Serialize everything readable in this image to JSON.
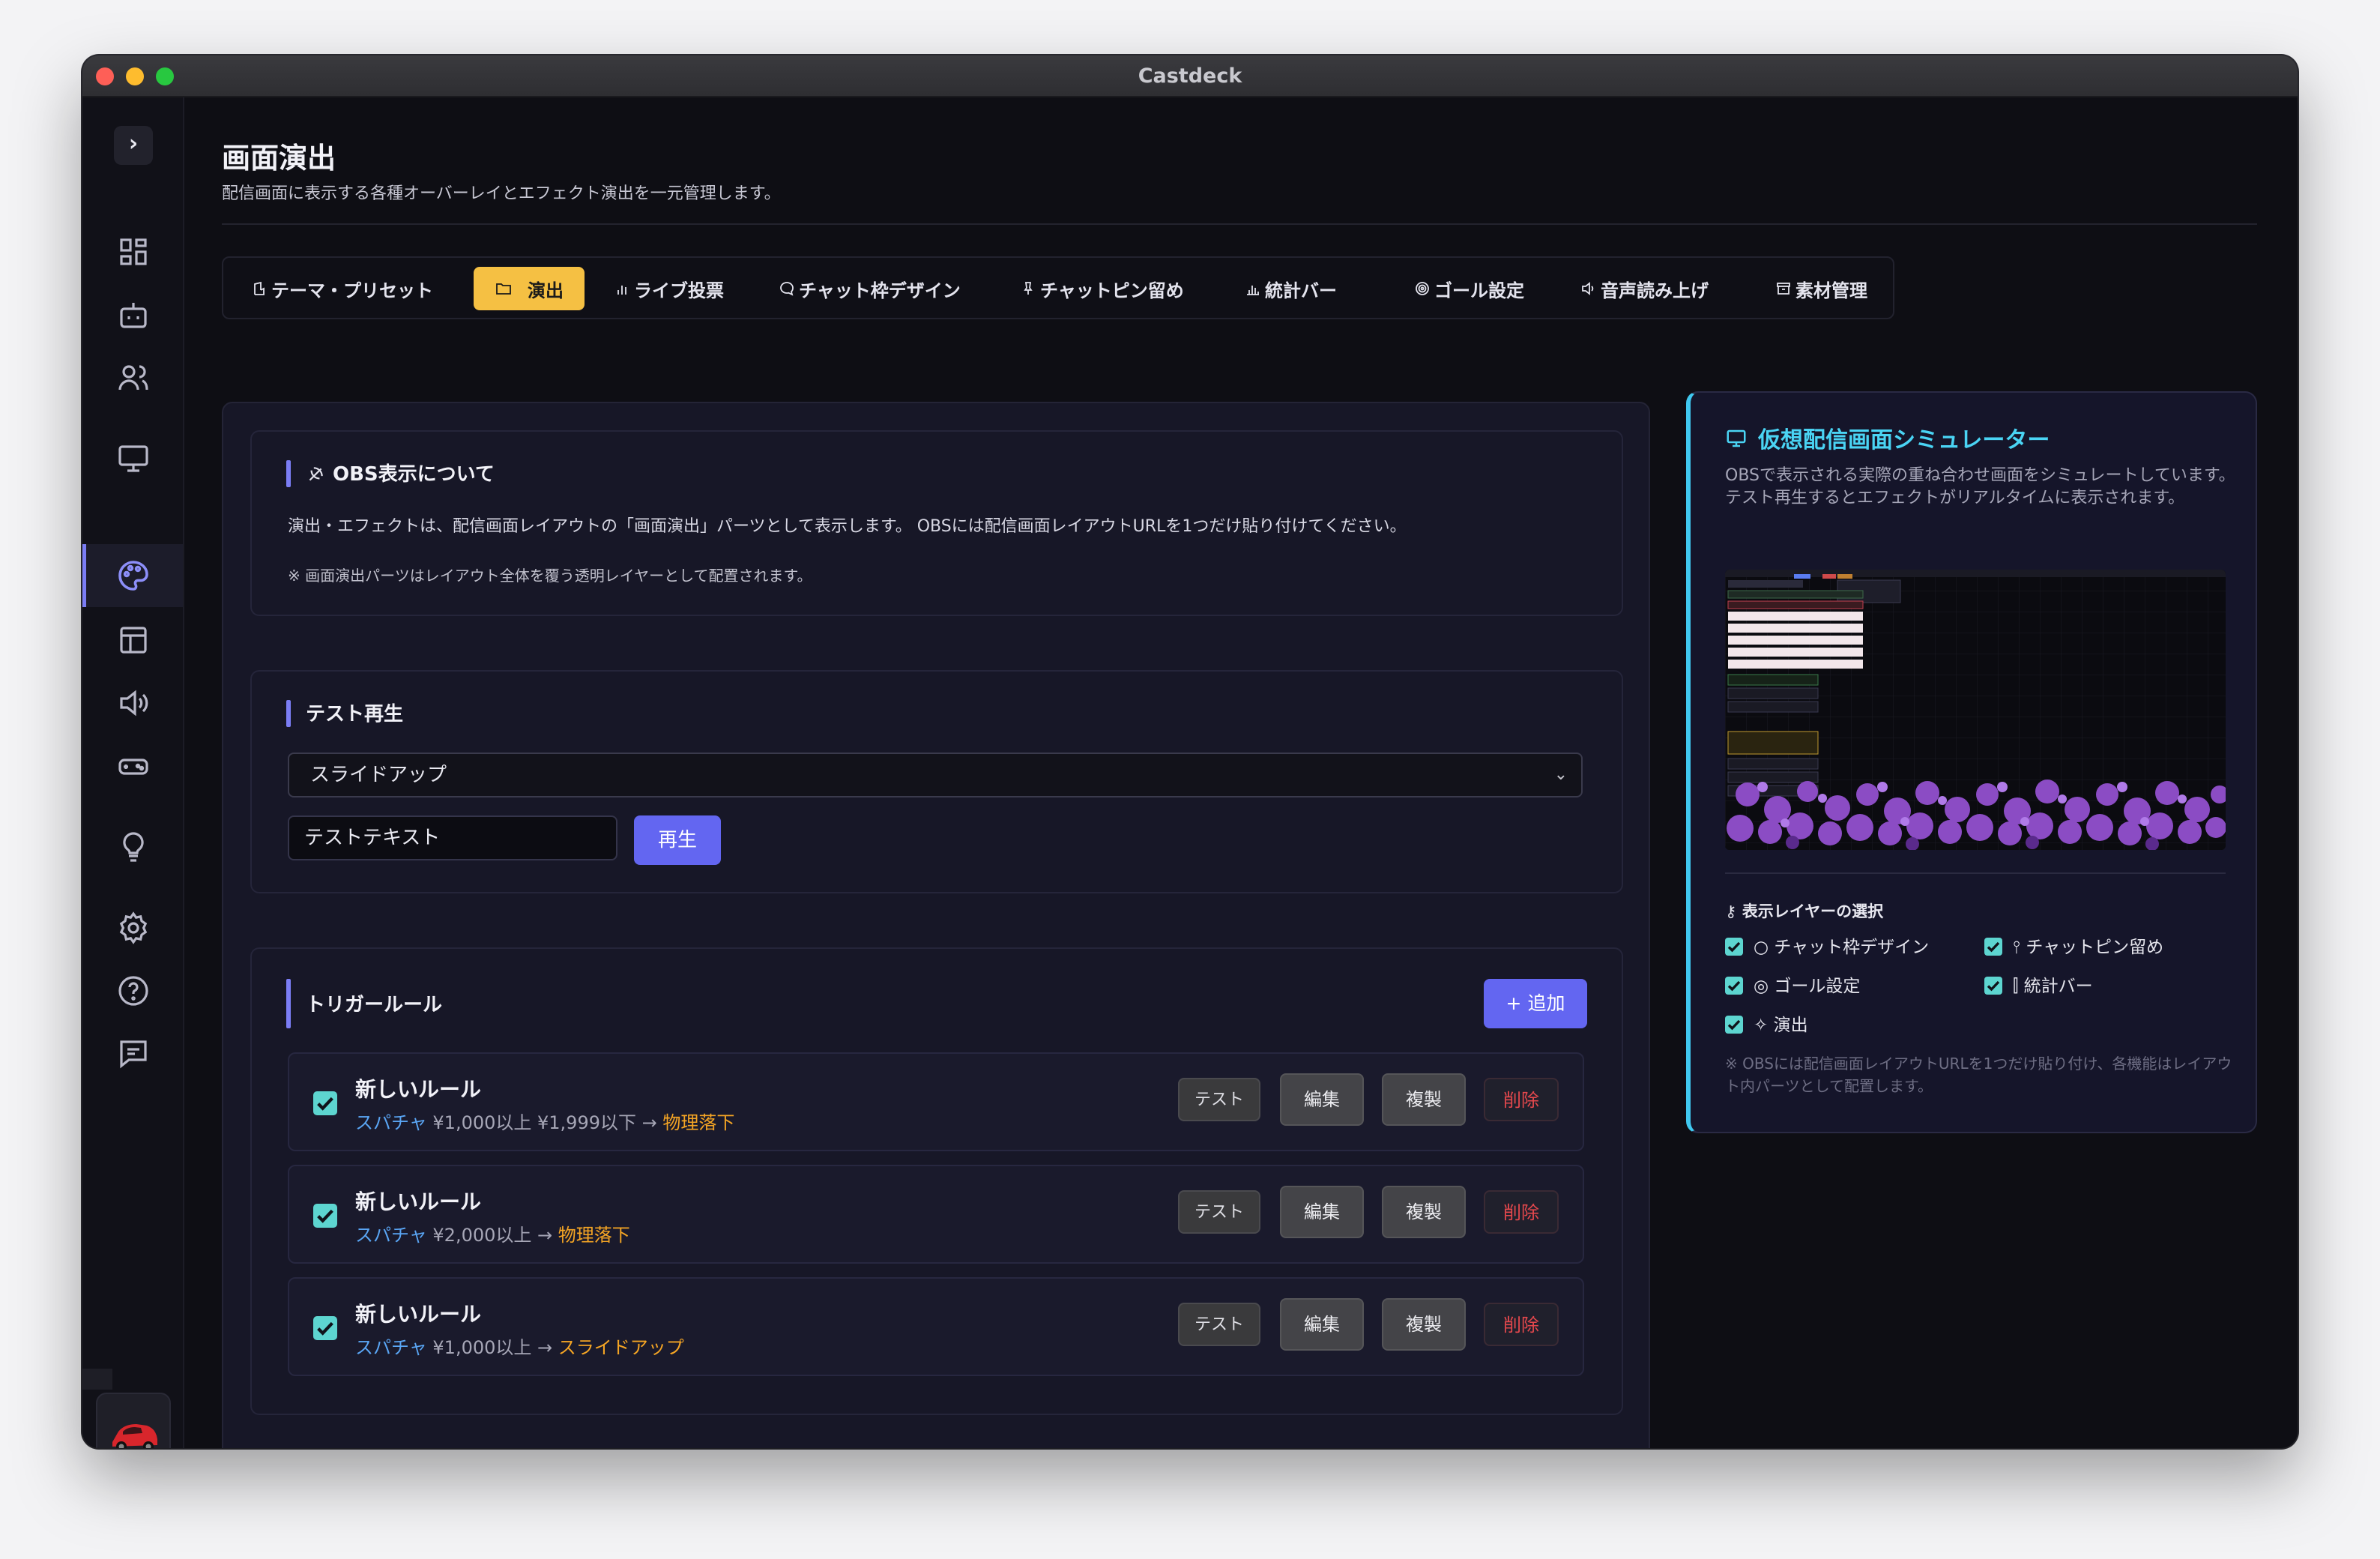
{
  "window": {
    "title": "Castdeck"
  },
  "sidebar": {
    "toggle_glyph": "›",
    "icons": [
      "dashboard-icon",
      "bot-icon",
      "users-icon",
      "monitor-icon",
      "palette-icon",
      "layout-icon",
      "speaker-icon",
      "gamepad-icon",
      "lightbulb-icon",
      "settings-icon",
      "help-icon",
      "chat-icon"
    ],
    "active": "palette-icon"
  },
  "header": {
    "title": "画面演出",
    "subtitle": "配信画面に表示する各種オーバーレイとエフェクト演出を一元管理します。"
  },
  "tabs": [
    {
      "label": "テーマ・プリセット",
      "icon": "palette-icon",
      "active": false
    },
    {
      "label": "演出",
      "icon": "folder-icon",
      "active": true
    },
    {
      "label": "ライブ投票",
      "icon": "bar-chart-icon",
      "active": false
    },
    {
      "label": "チャット枠デザイン",
      "icon": "chat-bubble-icon",
      "active": false
    },
    {
      "label": "チャットピン留め",
      "icon": "pin-icon",
      "active": false
    },
    {
      "label": "統計バー",
      "icon": "stats-icon",
      "active": false
    },
    {
      "label": "ゴール設定",
      "icon": "target-icon",
      "active": false
    },
    {
      "label": "音声読み上げ",
      "icon": "volume-icon",
      "active": false
    },
    {
      "label": "素材管理",
      "icon": "archive-icon",
      "active": false
    }
  ],
  "obs_info": {
    "title": "OBS表示について",
    "body": "演出・エフェクトは、配信画面レイアウトの「画面演出」パーツとして表示します。 OBSには配信画面レイアウトURLを1つだけ貼り付けてください。",
    "note": "※ 画面演出パーツはレイアウト全体を覆う透明レイヤーとして配置されます。"
  },
  "test_play": {
    "title": "テスト再生",
    "selected_effect": "スライドアップ",
    "text_value": "テストテキスト",
    "play_label": "再生"
  },
  "trigger_rules": {
    "title": "トリガールール",
    "add_label": "+ 追加",
    "buttons": {
      "test": "テスト",
      "edit": "編集",
      "copy": "複製",
      "delete": "削除"
    },
    "rules": [
      {
        "enabled": true,
        "name": "新しいルール",
        "trigger": "スパチャ",
        "condition": "¥1,000以上 ¥1,999以下",
        "arrow": "→",
        "effect": "物理落下"
      },
      {
        "enabled": true,
        "name": "新しいルール",
        "trigger": "スパチャ",
        "condition": "¥2,000以上",
        "arrow": "→",
        "effect": "物理落下"
      },
      {
        "enabled": true,
        "name": "新しいルール",
        "trigger": "スパチャ",
        "condition": "¥1,000以上",
        "arrow": "→",
        "effect": "スライドアップ"
      }
    ]
  },
  "simulator": {
    "title": "仮想配信画面シミュレーター",
    "description": "OBSで表示される実際の重ね合わせ画面をシミュレートしています。テスト再生するとエフェクトがリアルタイムに表示されます。",
    "layers_title": "表示レイヤーの選択",
    "layers": [
      {
        "label": "チャット枠デザイン",
        "icon": "chat-bubble-icon",
        "checked": true
      },
      {
        "label": "チャットピン留め",
        "icon": "pin-icon",
        "checked": true
      },
      {
        "label": "ゴール設定",
        "icon": "target-icon",
        "checked": true
      },
      {
        "label": "統計バー",
        "icon": "stats-icon",
        "checked": true
      },
      {
        "label": "演出",
        "icon": "sparkle-icon",
        "checked": true
      }
    ],
    "note": "※ OBSには配信画面レイアウトURLを1つだけ貼り付け、各機能はレイアウト内パーツとして配置します。"
  },
  "colors": {
    "accent": "#6366f1",
    "active_tab": "#f5c043",
    "checkbox": "#5dd5d0",
    "trigger_text": "#5aa6f5",
    "effect_text": "#f5a524",
    "delete_text": "#e5484d",
    "simulator_title": "#4ad4f4"
  }
}
